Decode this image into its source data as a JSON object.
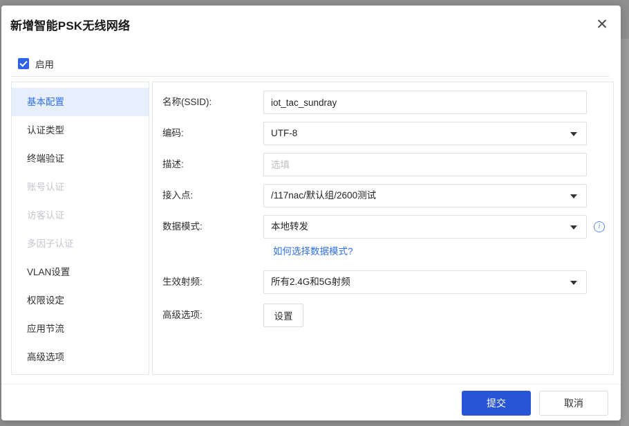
{
  "dialog": {
    "title": "新增智能PSK无线网络",
    "close_icon": "close-icon",
    "enable_label": "启用"
  },
  "sidebar": {
    "items": [
      {
        "label": "基本配置",
        "state": "active"
      },
      {
        "label": "认证类型",
        "state": "normal"
      },
      {
        "label": "终端验证",
        "state": "normal"
      },
      {
        "label": "账号认证",
        "state": "disabled"
      },
      {
        "label": "访客认证",
        "state": "disabled"
      },
      {
        "label": "多因子认证",
        "state": "disabled"
      },
      {
        "label": "VLAN设置",
        "state": "normal"
      },
      {
        "label": "权限设定",
        "state": "normal"
      },
      {
        "label": "应用节流",
        "state": "normal"
      },
      {
        "label": "高级选项",
        "state": "normal"
      }
    ]
  },
  "form": {
    "ssid": {
      "label": "名称(SSID):",
      "value": "iot_tac_sundray",
      "placeholder": ""
    },
    "encoding": {
      "label": "编码:",
      "value": "UTF-8"
    },
    "description": {
      "label": "描述:",
      "value": "",
      "placeholder": "选填"
    },
    "access_point": {
      "label": "接入点:",
      "value": "/117nac/默认组/2600测试"
    },
    "data_mode": {
      "label": "数据模式:",
      "value": "本地转发",
      "info_icon": "info-circle-icon"
    },
    "data_mode_help": "如何选择数据模式?",
    "radio_band": {
      "label": "生效射频:",
      "value": "所有2.4G和5G射频"
    },
    "advanced": {
      "label": "高级选项:",
      "button_label": "设置"
    }
  },
  "footer": {
    "submit_label": "提交",
    "cancel_label": "取消"
  },
  "colors": {
    "accent": "#2855d6",
    "active_item_bg": "#e8effc",
    "active_item_text": "#2f6fe8",
    "link": "#2f6fe8",
    "backdrop": "#8e8e8e"
  }
}
